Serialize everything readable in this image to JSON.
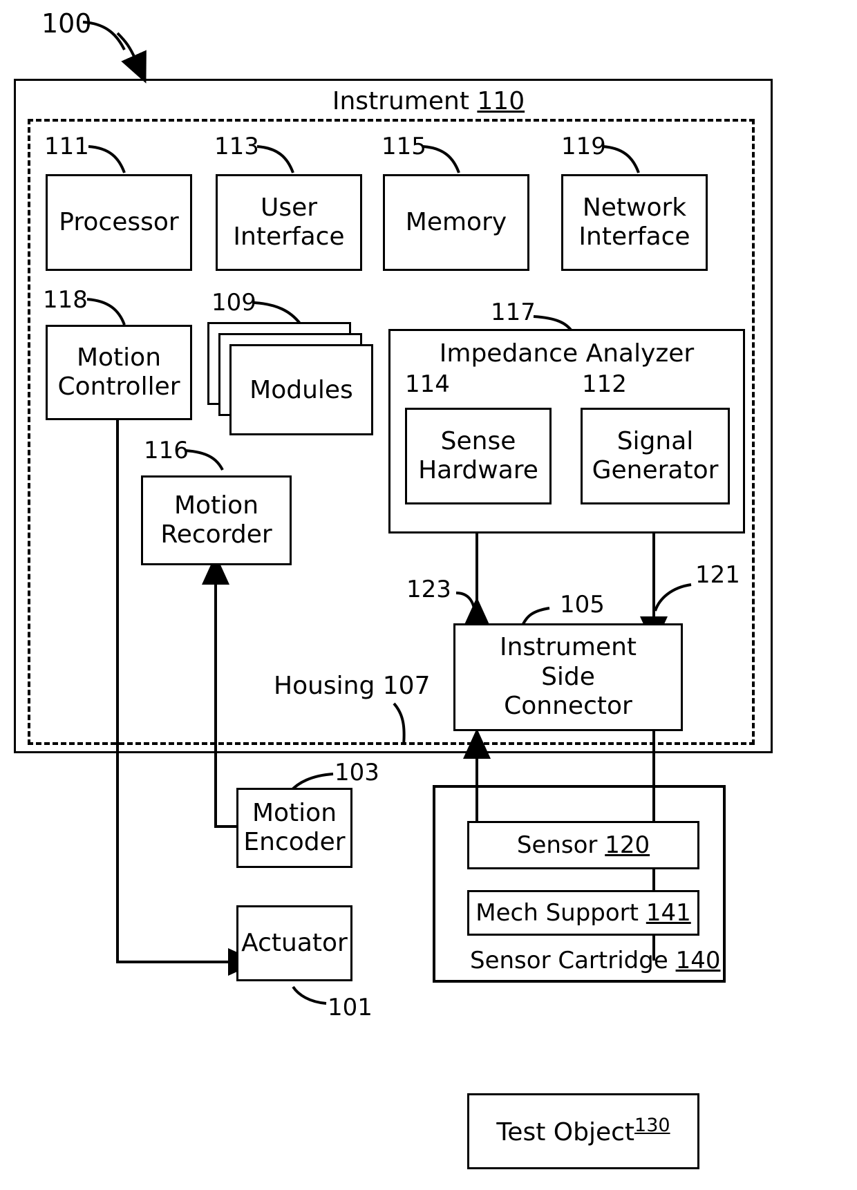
{
  "figure": {
    "figure_ref": "100",
    "instrument_title": "Instrument",
    "instrument_ref": "110",
    "housing_label": "Housing 107"
  },
  "blocks": {
    "processor": {
      "label": "Processor",
      "ref": "111"
    },
    "user_interface": {
      "label": "User\nInterface",
      "ref": "113",
      "line1": "User",
      "line2": "Interface"
    },
    "memory": {
      "label": "Memory",
      "ref": "115"
    },
    "network_interface": {
      "label": "Network\nInterface",
      "ref": "119",
      "line1": "Network",
      "line2": "Interface"
    },
    "motion_controller": {
      "label": "Motion\nController",
      "ref": "118",
      "line1": "Motion",
      "line2": "Controller"
    },
    "modules": {
      "label": "Modules",
      "ref": "109"
    },
    "motion_recorder": {
      "label": "Motion\nRecorder",
      "ref": "116",
      "line1": "Motion",
      "line2": "Recorder"
    },
    "impedance_analyzer": {
      "label": "Impedance Analyzer",
      "ref": "117"
    },
    "sense_hardware": {
      "label": "Sense\nHardware",
      "ref": "114",
      "line1": "Sense",
      "line2": "Hardware"
    },
    "signal_generator": {
      "label": "Signal\nGenerator",
      "ref": "112",
      "line1": "Signal",
      "line2": "Generator"
    },
    "instrument_side_connector": {
      "label": "Instrument\nSide\nConnector",
      "ref": "105",
      "line1": "Instrument",
      "line2": "Side",
      "line3": "Connector"
    },
    "motion_encoder": {
      "label": "Motion\nEncoder",
      "ref": "103",
      "line1": "Motion",
      "line2": "Encoder"
    },
    "actuator": {
      "label": "Actuator",
      "ref": "101"
    },
    "sensor": {
      "label": "Sensor ",
      "ref": "120"
    },
    "mech_support": {
      "label": "Mech Support ",
      "ref": "141"
    },
    "sensor_cartridge": {
      "label": "Sensor Cartridge ",
      "ref": "140"
    },
    "test_object": {
      "label": "Test Object",
      "ref": "130"
    }
  },
  "connections": {
    "sense_signal_ref": "123",
    "drive_signal_ref": "121"
  }
}
